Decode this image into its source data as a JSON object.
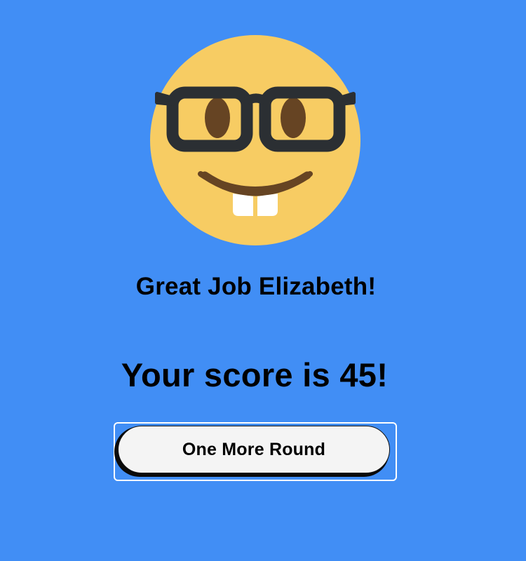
{
  "colors": {
    "background": "#418ef5",
    "face": "#f7cc63",
    "glasses": "#2b2f33",
    "eyes": "#664423",
    "teeth": "#ffffff",
    "button_bg": "#f4f4f4"
  },
  "result": {
    "emoji_icon": "nerd-face-icon",
    "greeting": "Great Job Elizabeth!",
    "score_text": "Your score is 45!"
  },
  "actions": {
    "play_again_label": "One More Round"
  }
}
